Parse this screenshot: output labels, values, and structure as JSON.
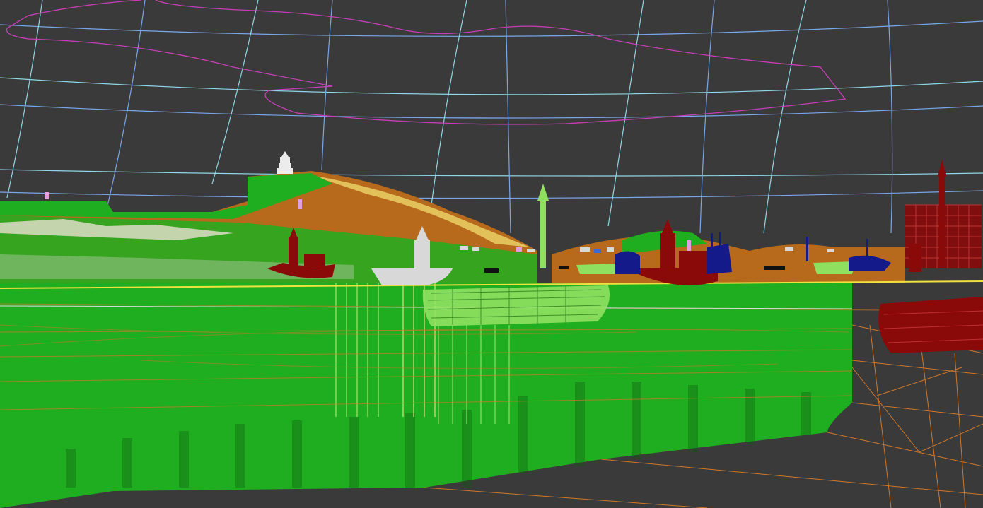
{
  "viewport": {
    "background_color": "#3a3a3a",
    "colors": {
      "sky_grid": "#8fd6e6",
      "sky_grid_blue": "#7aa6e8",
      "spline_magenta": "#c63fb5",
      "terrain_green": "#1fae1f",
      "terrain_dark_green": "#178a17",
      "hill_orange": "#b86a1c",
      "hill_yellow": "#e2c05a",
      "ship_red": "#8a0a0a",
      "ship_lightgreen": "#90e060",
      "ship_white": "#d8d8d8",
      "ship_navy": "#141a8a",
      "wire_orange": "#d0782a",
      "horizon_yellow": "#f0e040",
      "pink_marker": "#e0a0e0"
    },
    "objects": [
      "sky-dome-wireframe",
      "camera-spline",
      "mountain-left",
      "pagoda",
      "lighthouse-white",
      "red-junk-left",
      "green-ship-center",
      "red-junk-right",
      "navy-ships-right",
      "red-tall-ship-right",
      "water-plane-wireframe",
      "horizon-line"
    ]
  }
}
